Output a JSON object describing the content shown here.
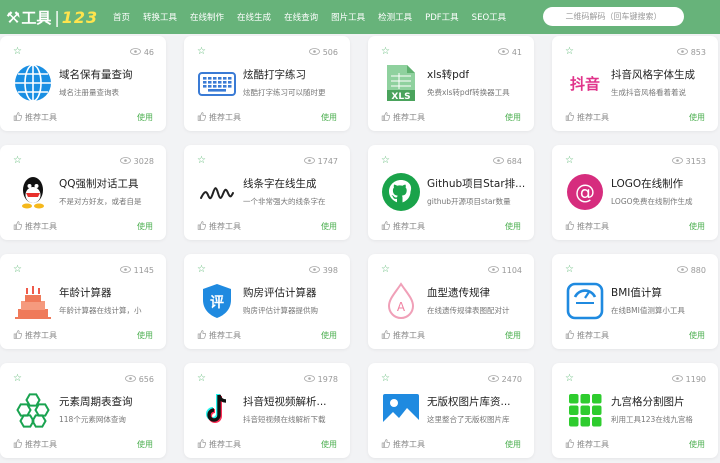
{
  "header": {
    "logo_icon": "⚒",
    "logo_text": "工具",
    "logo_sep": "|",
    "logo_num": "123",
    "nav": [
      "首页",
      "转换工具",
      "在线制作",
      "在线生成",
      "在线查询",
      "图片工具",
      "检测工具",
      "PDF工具",
      "SEO工具"
    ],
    "search_placeholder": "二维码解码（回车键搜索）"
  },
  "labels": {
    "recommend": "推荐工具",
    "use": "使用"
  },
  "colors": {
    "nav_bg": "#67b37a",
    "accent_green": "#4caf50"
  },
  "cards": [
    {
      "title": "域名保有量查询",
      "desc": "域名注册量查询表",
      "views": "46",
      "icon": "globe-icon"
    },
    {
      "title": "炫酷打字练习",
      "desc": "炫酷打字练习可以随时更",
      "views": "506",
      "icon": "keyboard-icon"
    },
    {
      "title": "xls转pdf",
      "desc": "免费xls转pdf转换器工具",
      "views": "41",
      "icon": "xls-icon",
      "icon_text": "XLS"
    },
    {
      "title": "抖音风格字体生成",
      "desc": "生成抖音风格看着着说",
      "views": "853",
      "icon": "douyin-font-icon",
      "icon_text": "抖音"
    },
    {
      "title": "QQ强制对话工具",
      "desc": "不是对方好友，或者自是",
      "views": "3028",
      "icon": "qq-icon"
    },
    {
      "title": "线条字在线生成",
      "desc": "一个非常强大的线条字在",
      "views": "1747",
      "icon": "line-text-icon"
    },
    {
      "title": "Github项目Star排...",
      "desc": "github开源项目star数量",
      "views": "684",
      "icon": "github-icon"
    },
    {
      "title": "LOGO在线制作",
      "desc": "LOGO免费在线制作生成",
      "views": "3153",
      "icon": "at-logo-icon",
      "icon_text": "@"
    },
    {
      "title": "年龄计算器",
      "desc": "年龄计算器在线计算，小",
      "views": "1145",
      "icon": "cake-icon"
    },
    {
      "title": "购房评估计算器",
      "desc": "购房评估计算器提供购",
      "views": "398",
      "icon": "shield-icon",
      "icon_text": "评"
    },
    {
      "title": "血型遗传规律",
      "desc": "在线遗传规律表图配对计",
      "views": "1104",
      "icon": "blood-drop-icon",
      "icon_text": "A"
    },
    {
      "title": "BMI值计算",
      "desc": "在线BMI值测算小工具",
      "views": "880",
      "icon": "scale-icon"
    },
    {
      "title": "元素周期表查询",
      "desc": "118个元素网体查询",
      "views": "656",
      "icon": "hexagon-icon"
    },
    {
      "title": "抖音短视频解析...",
      "desc": "抖音短视频在线解析下载",
      "views": "1978",
      "icon": "tiktok-icon"
    },
    {
      "title": "无版权图片库资...",
      "desc": "这里整合了无版权图片库",
      "views": "2470",
      "icon": "image-icon"
    },
    {
      "title": "九宫格分割图片",
      "desc": "利用工具123在线九宫格",
      "views": "1190",
      "icon": "grid9-icon"
    }
  ]
}
